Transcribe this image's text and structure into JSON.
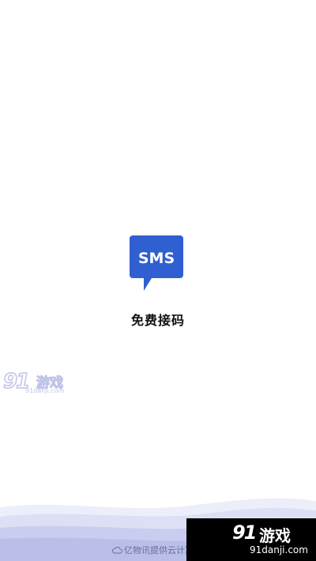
{
  "app": {
    "name": "免费接码",
    "icon_text": "SMS",
    "icon_color": "#2f5fd0"
  },
  "footer": {
    "credit": "亿物讯提供云计算服务"
  },
  "watermark": {
    "logo_number": "91",
    "logo_name": "游戏",
    "domain": "91danji.com"
  },
  "colors": {
    "background": "#ffffff",
    "wave_light": "#e6e8f7",
    "wave_mid": "#cfd3f0",
    "wave_dark": "#b9bfe8"
  }
}
